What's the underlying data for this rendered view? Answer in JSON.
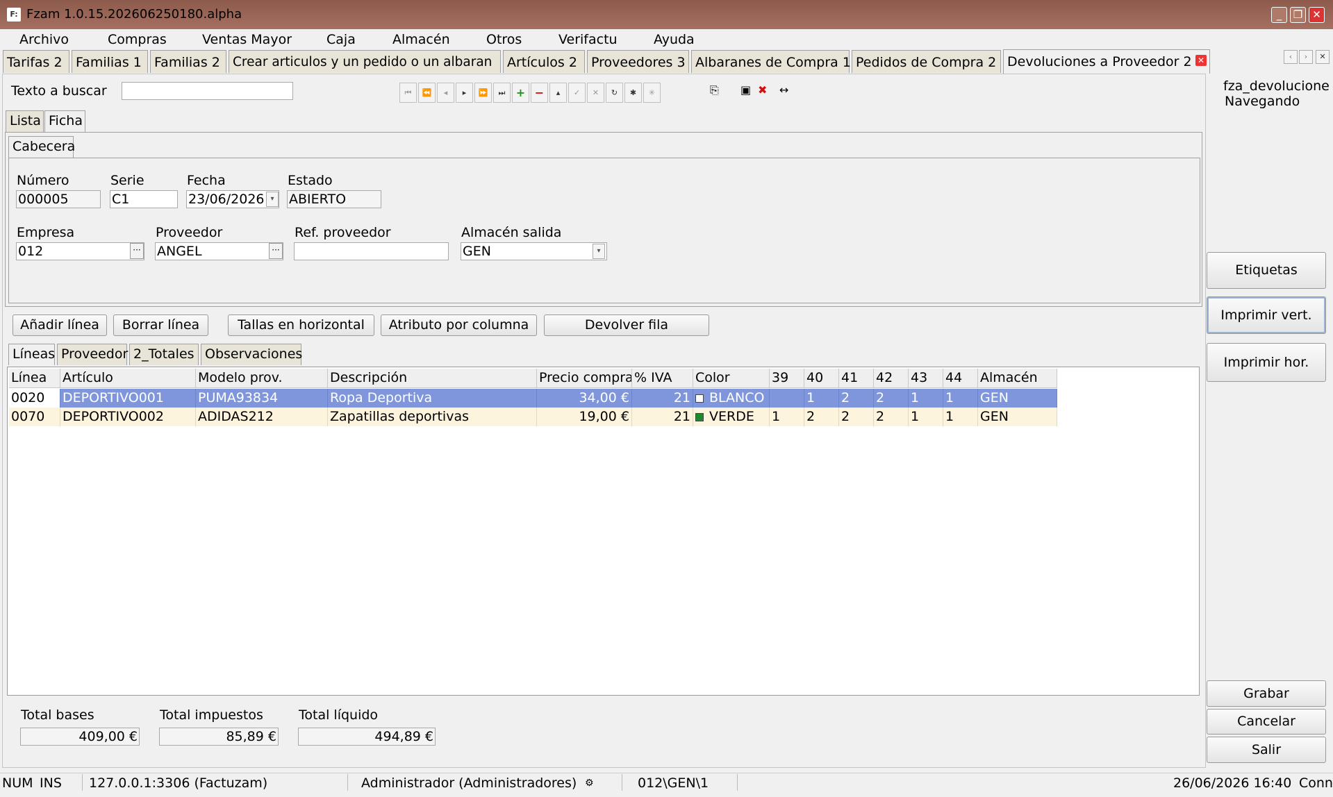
{
  "window": {
    "title": "Fzam 1.0.15.202606250180.alpha",
    "icon_text": "F:"
  },
  "menu": [
    "Archivo",
    "Compras",
    "Ventas Mayor",
    "Caja",
    "Almacén",
    "Otros",
    "Verifactu",
    "Ayuda"
  ],
  "tabs": [
    "Tarifas 2",
    "Familias 1",
    "Familias 2",
    "Crear articulos y un pedido o un albaran",
    "Artículos 2",
    "Proveedores 3",
    "Albaranes de Compra 1",
    "Pedidos de Compra 2",
    "Devoluciones a Proveedor 2"
  ],
  "search": {
    "label": "Texto a buscar",
    "value": ""
  },
  "info": {
    "table": "fza_devolucione",
    "mode": "Navegando"
  },
  "view_tabs": [
    "Lista",
    "Ficha"
  ],
  "section_tab": "Cabecera",
  "header": {
    "numero": {
      "label": "Número",
      "value": "000005"
    },
    "serie": {
      "label": "Serie",
      "value": "C1"
    },
    "fecha": {
      "label": "Fecha",
      "value": "23/06/2026"
    },
    "estado": {
      "label": "Estado",
      "value": "ABIERTO"
    },
    "empresa": {
      "label": "Empresa",
      "value": "012"
    },
    "proveedor": {
      "label": "Proveedor",
      "value": "ANGEL"
    },
    "ref_proveedor": {
      "label": "Ref. proveedor",
      "value": ""
    },
    "almacen_salida": {
      "label": "Almacén salida",
      "value": "GEN"
    }
  },
  "line_buttons": {
    "add": "Añadir línea",
    "delete": "Borrar línea",
    "sizes": "Tallas en horizontal",
    "attr": "Atributo por columna",
    "return": "Devolver fila"
  },
  "detail_tabs": [
    "Líneas",
    "Proveedor",
    "2_Totales",
    "Observaciones"
  ],
  "grid": {
    "columns": [
      "Línea",
      "Artículo",
      "Modelo prov.",
      "Descripción",
      "Precio compra",
      "% IVA",
      "Color",
      "39",
      "40",
      "41",
      "42",
      "43",
      "44",
      "Almacén"
    ],
    "rows": [
      {
        "linea": "0020",
        "articulo": "DEPORTIVO001",
        "modelo": "PUMA93834",
        "descripcion": "Ropa Deportiva",
        "precio": "34,00 €",
        "iva": "21",
        "color": "BLANCO",
        "color_hex": "#ffffff",
        "s39": "",
        "s40": "1",
        "s41": "2",
        "s42": "2",
        "s43": "1",
        "s44": "1",
        "almacen": "GEN"
      },
      {
        "linea": "0070",
        "articulo": "DEPORTIVO002",
        "modelo": "ADIDAS212",
        "descripcion": "Zapatillas deportivas",
        "precio": "19,00 €",
        "iva": "21",
        "color": "VERDE",
        "color_hex": "#1e8a2e",
        "s39": "1",
        "s40": "2",
        "s41": "2",
        "s42": "2",
        "s43": "1",
        "s44": "1",
        "almacen": "GEN"
      }
    ]
  },
  "totals": {
    "bases": {
      "label": "Total bases",
      "value": "409,00 €"
    },
    "impuestos": {
      "label": "Total impuestos",
      "value": "85,89 €"
    },
    "liquido": {
      "label": "Total líquido",
      "value": "494,89 €"
    }
  },
  "side_buttons": {
    "etiquetas": "Etiquetas",
    "imprimir_vert": "Imprimir vert.",
    "imprimir_hor": "Imprimir hor.",
    "grabar": "Grabar",
    "cancelar": "Cancelar",
    "salir": "Salir"
  },
  "status": {
    "num": "NUM",
    "ins": "INS",
    "server": "127.0.0.1:3306 (Factuzam)",
    "user": "Administrador (Administradores)",
    "path": "012\\GEN\\1",
    "datetime": "26/06/2026 16:40",
    "conn": "Conn"
  }
}
